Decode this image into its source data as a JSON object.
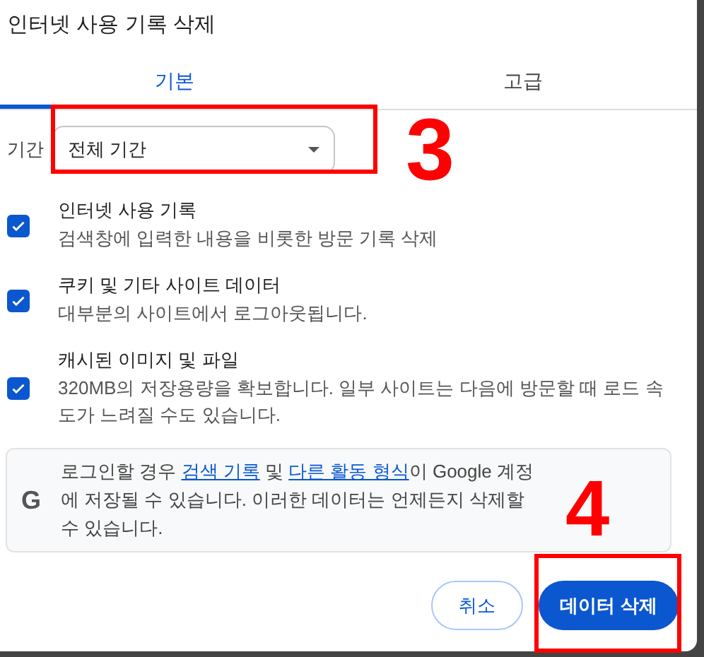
{
  "dialog": {
    "title": "인터넷 사용 기록 삭제"
  },
  "tabs": [
    {
      "label": "기본",
      "selected": true
    },
    {
      "label": "고급",
      "selected": false
    }
  ],
  "period": {
    "label": "기간",
    "value": "전체 기간"
  },
  "options": [
    {
      "title": "인터넷 사용 기록",
      "description": "검색창에 입력한 내용을 비롯한 방문 기록 삭제",
      "checked": true
    },
    {
      "title": "쿠키 및 기타 사이트 데이터",
      "description": "대부분의 사이트에서 로그아웃됩니다.",
      "checked": true
    },
    {
      "title": "캐시된 이미지 및 파일",
      "description": "320MB의 저장용량을 확보합니다. 일부 사이트는 다음에 방문할 때 로드 속도가 느려질 수도 있습니다.",
      "checked": true
    }
  ],
  "notice": {
    "icon_letter": "G",
    "parts": [
      {
        "kind": "text",
        "text": "로그인할 경우 "
      },
      {
        "kind": "link",
        "text": "검색 기록"
      },
      {
        "kind": "text",
        "text": " 및 "
      },
      {
        "kind": "link",
        "text": "다른 활동 형식"
      },
      {
        "kind": "text",
        "text": "이 Google 계정에 저장될 수 있습니다. 이러한 데이터는 언제든지 삭제할 수 있습니다."
      }
    ]
  },
  "buttons": [
    {
      "label": "취소",
      "kind": "secondary"
    },
    {
      "label": "데이터 삭제",
      "kind": "primary"
    }
  ],
  "annotations": [
    {
      "number": "3"
    },
    {
      "number": "4"
    }
  ]
}
